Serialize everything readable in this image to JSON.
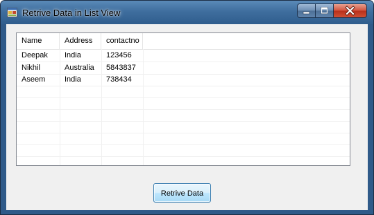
{
  "window": {
    "title": "Retrive Data in List View"
  },
  "listview": {
    "columns": [
      "Name",
      "Address",
      "contactno"
    ],
    "rows": [
      [
        "Deepak",
        "India",
        "123456"
      ],
      [
        "Nikhil",
        "Australia",
        "5843837"
      ],
      [
        "Aseem",
        "India",
        "738434"
      ]
    ]
  },
  "button": {
    "label": "Retrive Data"
  },
  "colors": {
    "titlebar": "#3f6e9e",
    "close_button": "#c8432b",
    "client_bg": "#f0f0f0",
    "button_border": "#3c7fb1"
  },
  "icons": [
    "app-icon",
    "minimize-icon",
    "maximize-icon",
    "close-icon"
  ]
}
